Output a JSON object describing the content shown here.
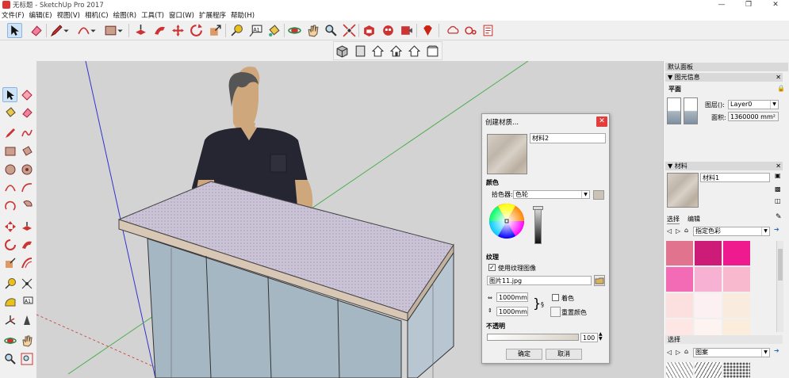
{
  "window": {
    "title": "无标题 - SketchUp Pro 2017",
    "controls": [
      "—",
      "❐",
      "✕"
    ]
  },
  "menu": [
    "文件(F)",
    "编辑(E)",
    "视图(V)",
    "相机(C)",
    "绘图(R)",
    "工具(T)",
    "窗口(W)",
    "扩展程序",
    "帮助(H)"
  ],
  "toolbar": {
    "tools": [
      "select-tool",
      "eraser-tool",
      "pencil-tool",
      "arc-tool",
      "rectangle-tool",
      "pushpull-tool",
      "followme-tool",
      "move-tool",
      "rotate-tool",
      "scale-tool",
      "tape-tool",
      "text-tool",
      "paint-tool",
      "orbit-tool",
      "pan-tool",
      "zoom-extents-tool",
      "warehouse-tool",
      "extension-tool",
      "share-tool",
      "ruby-tool",
      "cloud-tool",
      "layout-tool"
    ]
  },
  "views_toolbar": {
    "tools": [
      "iso-view",
      "top-view",
      "front-view",
      "right-view",
      "back-view",
      "left-view"
    ]
  },
  "dialog": {
    "title": "创建材质...",
    "material_name": "材料2",
    "color_section": "颜色",
    "picker_label": "拾色器:",
    "picker_value": "色轮",
    "texture_section": "纹理",
    "use_texture_label": "使用纹理图像",
    "use_texture_checked": "✓",
    "texture_file": "图片11.jpg",
    "width_value": "1000mm",
    "height_value": "1000mm",
    "colorize_label": "着色",
    "reset_color_label": "重置颜色",
    "opacity_section": "不透明",
    "opacity_value": "100",
    "ok_label": "确定",
    "cancel_label": "取消"
  },
  "panel": {
    "title": "默认面板",
    "entity_info": {
      "header": "图元信息",
      "type": "平面",
      "layer_label": "图层():",
      "layer_value": "Layer0",
      "area_label": "面积:",
      "area_value": "1360000 mm²"
    },
    "materials": {
      "header": "材料",
      "name": "材料1",
      "tab_select": "选择",
      "tab_edit": "编辑",
      "collection": "指定色彩",
      "swatches": [
        "#e2738f",
        "#cc1c78",
        "#ef1a8e",
        "#f46bb5",
        "#f7b1d3",
        "#f8b9cf",
        "#fbe0df",
        "#fdf0f2",
        "#f9ecdf",
        "#fde6e4",
        "#fdf3f1",
        "#fbecdc"
      ],
      "secondary_label": "选择",
      "secondary_collection": "图案"
    }
  },
  "colors": {
    "accent": "#e23c3c",
    "shirt": "#262633",
    "skin": "#cfa77c",
    "counter_top": "#cbc3d6",
    "counter_side": "#a6b7c4"
  }
}
